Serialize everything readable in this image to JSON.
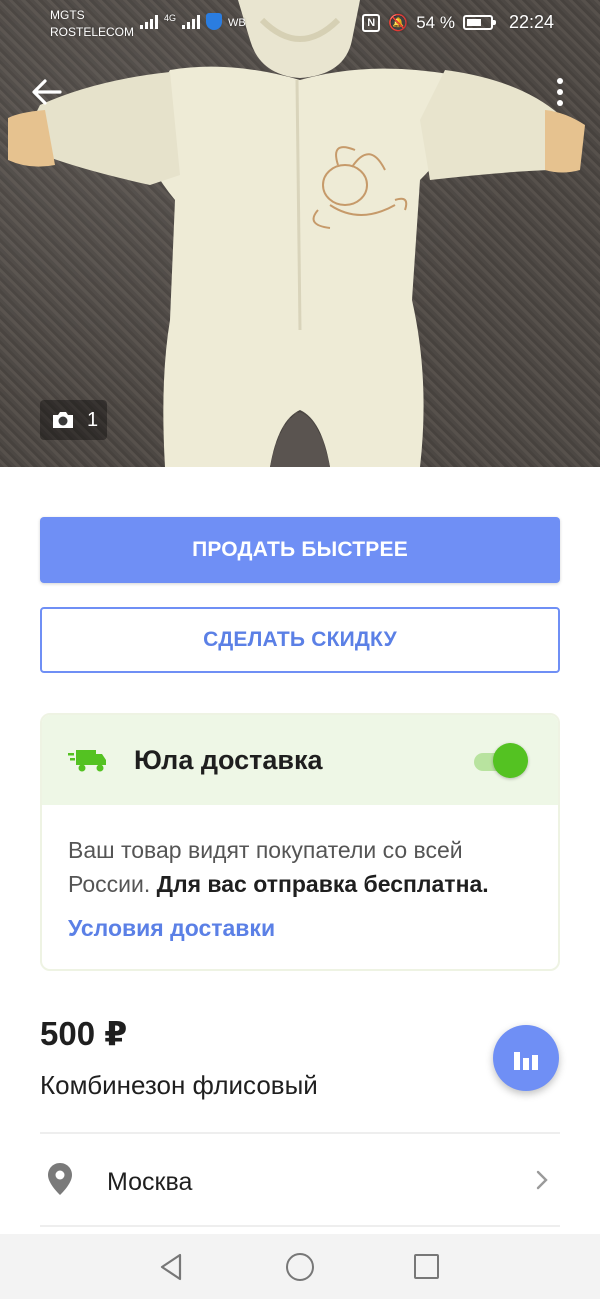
{
  "status_bar": {
    "carrier_1": "MGTS",
    "carrier_2": "ROSTELECOM",
    "network_type": "4G",
    "vpn_label": "WB",
    "battery": "54 %",
    "time": "22:24"
  },
  "photo": {
    "count": "1",
    "icons": {
      "back": "arrow-left-icon",
      "menu": "more-vertical-icon",
      "camera": "camera-icon"
    }
  },
  "actions": {
    "sell_faster": "ПРОДАТЬ БЫСТРЕЕ",
    "make_discount": "СДЕЛАТЬ СКИДКУ"
  },
  "delivery": {
    "title": "Юла доставка",
    "enabled": true,
    "description": "Ваш товар видят покупатели со всей России.",
    "description_bold": "Для вас отправка бесплатна.",
    "link": "Условия доставки",
    "colors": {
      "accent": "#54c222",
      "header_bg": "#eef7e6"
    }
  },
  "listing": {
    "price": "500 ₽",
    "title": "Комбинезон флисовый",
    "location": "Москва"
  },
  "colors": {
    "primary": "#6f8ff5",
    "link": "#5b80e6"
  }
}
